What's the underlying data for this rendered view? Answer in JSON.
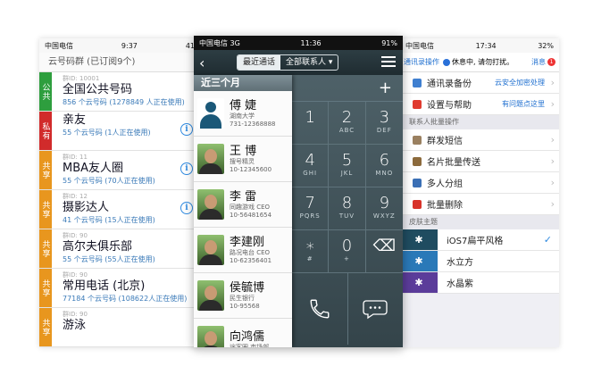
{
  "left": {
    "status": {
      "carrier": "中国电信",
      "time": "9:37",
      "extra": "41"
    },
    "subtitle": "云号码群 (已订阅9个)",
    "groups": [
      {
        "tag": "公共",
        "tag_color": "#2e9e3e",
        "gid": "群ID: 10001",
        "name": "全国公共号码",
        "sub": "856 个云号码 (1278849 人正在使用)",
        "info": false
      },
      {
        "tag": "私有",
        "tag_color": "#d12b2b",
        "gid": "",
        "name": "亲友",
        "sub": "55 个云号码 (1人正在使用)",
        "info": true
      },
      {
        "tag": "共享",
        "tag_color": "#e8961e",
        "gid": "群ID: 11",
        "name": "MBA友人圈",
        "sub": "55 个云号码 (70人正在使用)",
        "info": true
      },
      {
        "tag": "共享",
        "tag_color": "#e8961e",
        "gid": "群ID: 12",
        "name": "摄影达人",
        "sub": "41 个云号码 (15人正在使用)",
        "info": true
      },
      {
        "tag": "共享",
        "tag_color": "#e8961e",
        "gid": "群ID: 90",
        "name": "高尔夫俱乐部",
        "sub": "55 个云号码 (55人正在使用)",
        "info": false
      },
      {
        "tag": "共享",
        "tag_color": "#e8961e",
        "gid": "群ID: 90",
        "name": "常用电话 (北京)",
        "sub": "77184 个云号码 (108622人正在使用)",
        "info": false
      },
      {
        "tag": "共享",
        "tag_color": "#e8961e",
        "gid": "群ID: 90",
        "name": "游泳",
        "sub": "",
        "info": false
      }
    ]
  },
  "center": {
    "status": {
      "carrier": "中国电信",
      "network": "3G",
      "time": "11:36",
      "battery": "91%"
    },
    "tab_recent": "最近通话",
    "tab_all": "全部联系人 ▾",
    "list_header": "近三个月",
    "contacts": [
      {
        "name": "傅 婕",
        "line1": "湖南大学",
        "line2": "731-12368888",
        "avatar": "default"
      },
      {
        "name": "王 博",
        "line1": "搜号精灵",
        "line2": "10-12345600",
        "avatar": "photo"
      },
      {
        "name": "李 雷",
        "line1": "同趣游戏 CEO",
        "line2": "10-56481654",
        "avatar": "photo"
      },
      {
        "name": "李建刚",
        "line1": "路况电台 CEO",
        "line2": "10-62356401",
        "avatar": "photo"
      },
      {
        "name": "侯毓博",
        "line1": "民生银行",
        "line2": "10-95568",
        "avatar": "photo"
      },
      {
        "name": "向鸿儒",
        "line1": "途客圈 市场部",
        "line2": "",
        "avatar": "photo"
      }
    ],
    "keys": [
      {
        "d": "1",
        "l": ""
      },
      {
        "d": "2",
        "l": "ABC"
      },
      {
        "d": "3",
        "l": "DEF"
      },
      {
        "d": "4",
        "l": "GHI"
      },
      {
        "d": "5",
        "l": "JKL"
      },
      {
        "d": "6",
        "l": "MNO"
      },
      {
        "d": "7",
        "l": "PQRS"
      },
      {
        "d": "8",
        "l": "TUV"
      },
      {
        "d": "9",
        "l": "WXYZ"
      },
      {
        "d": "∗",
        "l": "#"
      },
      {
        "d": "0",
        "l": "+"
      },
      {
        "d": "⌫",
        "l": ""
      }
    ]
  },
  "right": {
    "status": {
      "carrier": "中国电信",
      "time": "17:34",
      "battery": "32%"
    },
    "top": {
      "left": "通讯录操作",
      "status": "休息中, 请勿打扰。",
      "msg": "消息",
      "badge": "1"
    },
    "rows": [
      {
        "label": "通讯录备份",
        "right": "云安全加密处理",
        "icon_color": "#3f7fd0"
      },
      {
        "label": "设置与帮助",
        "right": "有问题点这里",
        "icon_color": "#e03b2f"
      }
    ],
    "section_batch": "联系人批量操作",
    "batch": [
      {
        "label": "群发短信",
        "icon_color": "#9a8060"
      },
      {
        "label": "名片批量传送",
        "icon_color": "#8c6a3c"
      },
      {
        "label": "多人分组",
        "icon_color": "#3a6fb5"
      },
      {
        "label": "批量删除",
        "icon_color": "#d8332a"
      }
    ],
    "section_skin": "皮肤主题",
    "skins": [
      {
        "label": "iOS7扁平风格",
        "color": "#1f4c60",
        "checked": true
      },
      {
        "label": "水立方",
        "color": "#2a79b8",
        "checked": false
      },
      {
        "label": "水晶紫",
        "color": "#5b3c9a",
        "checked": false
      }
    ]
  }
}
